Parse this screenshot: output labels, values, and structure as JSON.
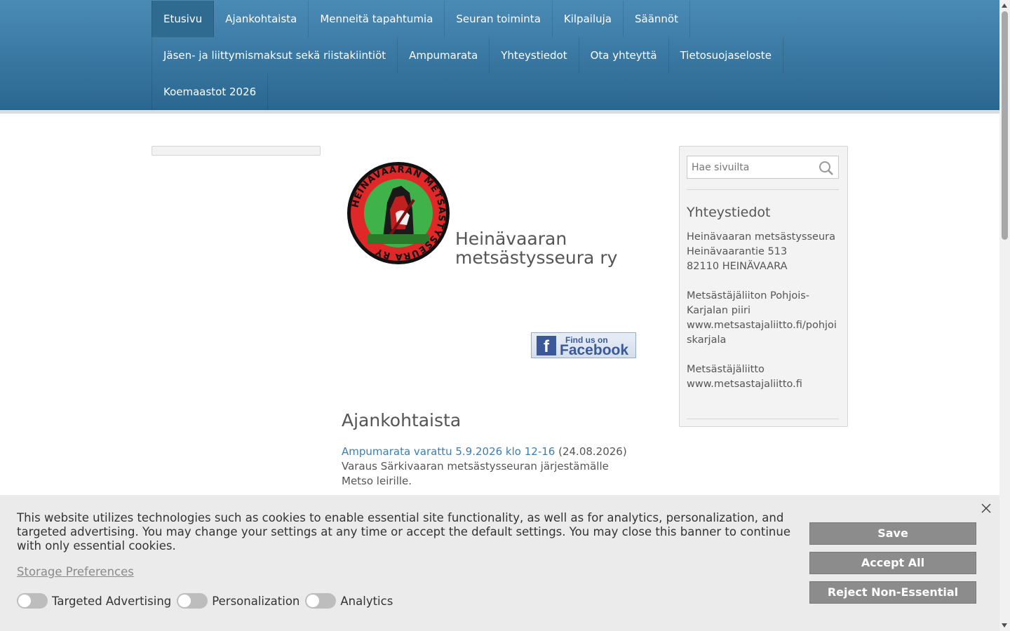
{
  "nav": {
    "row1": [
      "Etusivu",
      "Ajankohtaista",
      "Menneitä tapahtumia",
      "Seuran toiminta",
      "Kilpailuja",
      "Säännöt"
    ],
    "row2": [
      "Jäsen- ja liittymismaksut sekä riistakiintiöt",
      "Ampumarata",
      "Yhteystiedot",
      "Ota yhteyttä",
      "Tietosuojaseloste"
    ],
    "row3": [
      "Koemaastot 2026"
    ],
    "active": "Etusivu"
  },
  "logo": {
    "ring_text": "HEINÄVAARAN METSÄSTYSSEURA RY"
  },
  "site_title": {
    "line1": "Heinävaaran",
    "line2": "metsästysseura ry"
  },
  "facebook": {
    "find_text": "Find us on",
    "name": "Facebook",
    "f": "f"
  },
  "news": {
    "heading": "Ajankohtaista",
    "items": [
      {
        "title": "Ampumarata varattu 5.9.2026 klo 12-16",
        "date": "(24.08.2026)",
        "body": "Varaus Särkivaaran metsästysseuran järjestämälle Metso leirille."
      }
    ]
  },
  "sidebar": {
    "search_placeholder": "Hae sivuilta",
    "heading": "Yhteystiedot",
    "address": [
      "Heinävaaran metsästysseura",
      "Heinävaarantie 513",
      "82110 HEINÄVAARA"
    ],
    "district": [
      "Metsästäjäliiton Pohjois-Karjalan piiri",
      "www.metsastajaliitto.fi/pohjoiskarjala"
    ],
    "federation": [
      "Metsästäjäliitto",
      "www.metsastajaliitto.fi"
    ]
  },
  "cookie": {
    "text": "This website utilizes technologies such as cookies to enable essential site functionality, as well as for analytics, personalization, and targeted advertising. You may change your settings at any time or accept the default settings. You may close this banner to continue with only essential cookies.",
    "storage_link": "Storage Preferences",
    "toggles": [
      "Targeted Advertising",
      "Personalization",
      "Analytics"
    ],
    "save": "Save",
    "accept": "Accept All",
    "reject": "Reject Non-Essential"
  }
}
